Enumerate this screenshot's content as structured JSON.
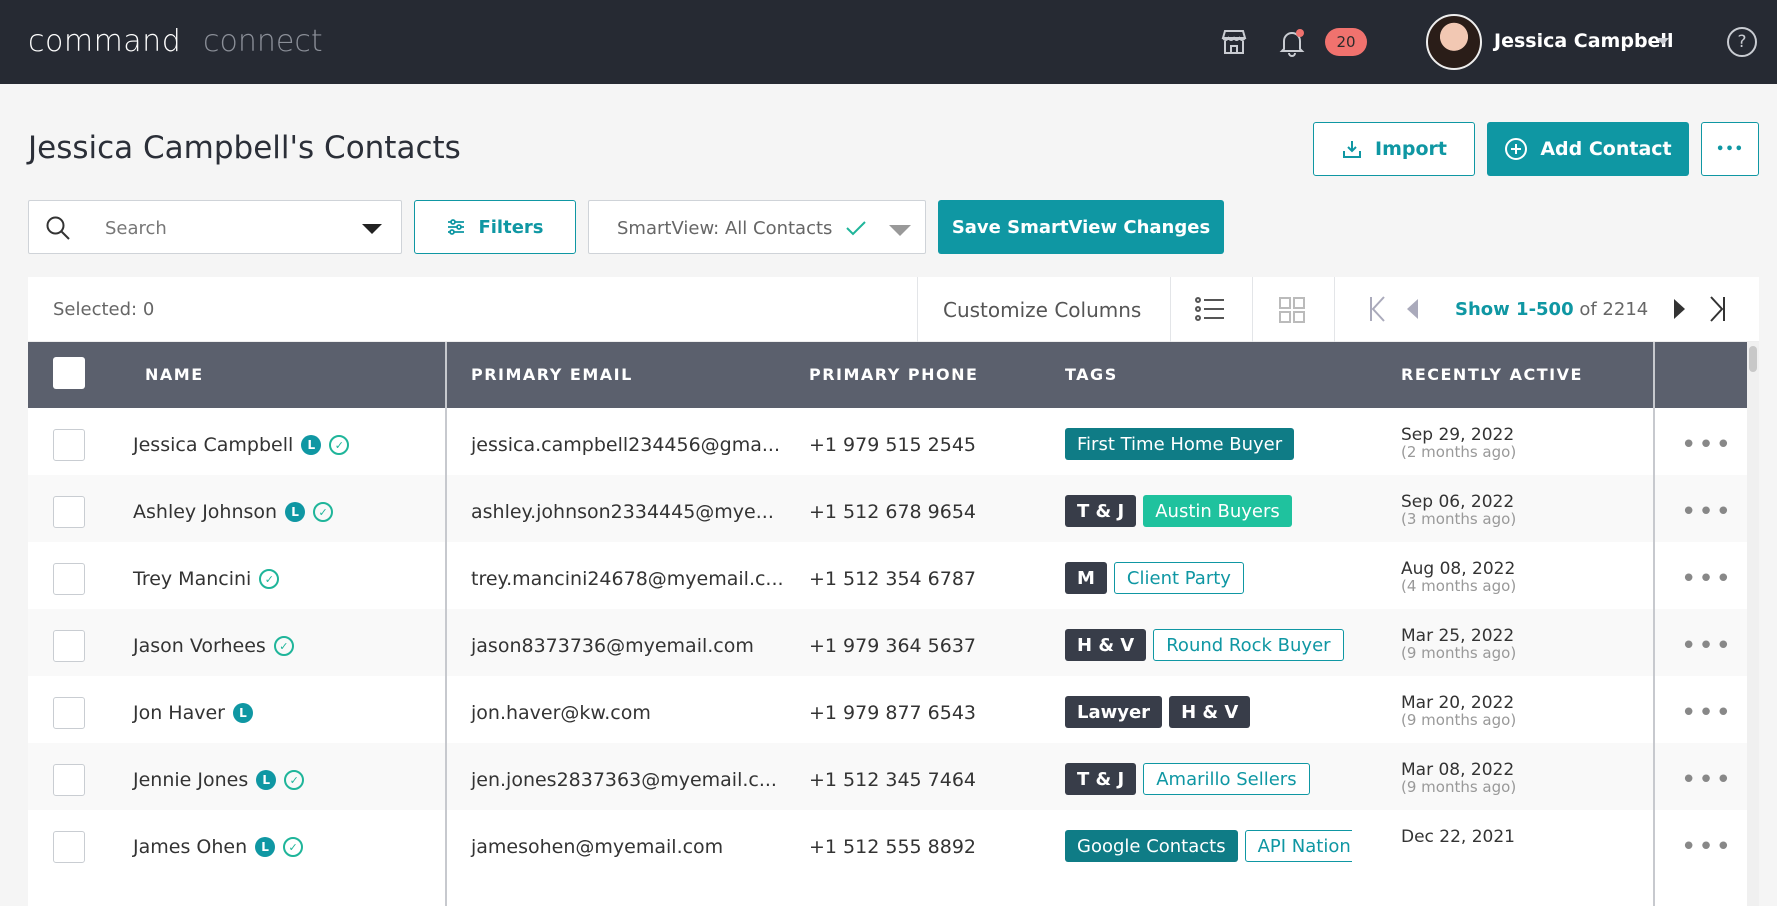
{
  "topbar": {
    "brand_command": "command",
    "brand_connect": "connect",
    "notification_count": "20",
    "user_name": "Jessica Campbell",
    "help_label": "?"
  },
  "header": {
    "title": "Jessica Campbell's Contacts",
    "import_label": "Import",
    "add_contact_label": "Add Contact",
    "more_label": "•••"
  },
  "toolbar": {
    "search_placeholder": "Search",
    "filters_label": "Filters",
    "smartview_label": "SmartView: All Contacts",
    "save_label": "Save SmartView Changes"
  },
  "statusbar": {
    "selected": "Selected: 0",
    "customize_label": "Customize Columns",
    "show_label": "Show 1-500",
    "show_total": "of 2214"
  },
  "columns": {
    "name": "NAME",
    "email": "PRIMARY EMAIL",
    "phone": "PRIMARY PHONE",
    "tags": "TAGS",
    "recent": "RECENTLY ACTIVE"
  },
  "badges": {
    "l": "L",
    "v": "✓"
  },
  "rows": [
    {
      "name": "Jessica Campbell",
      "l": true,
      "v": true,
      "email": "jessica.campbell234456@gma...",
      "phone": "+1 979 515 2545",
      "tags": [
        {
          "label": "First Time Home Buyer",
          "style": "teal"
        }
      ],
      "date": "Sep 29, 2022",
      "ago": "(2 months ago)"
    },
    {
      "name": "Ashley Johnson",
      "l": true,
      "v": true,
      "email": "ashley.johnson2334445@mye...",
      "phone": "+1 512 678 9654",
      "tags": [
        {
          "label": "T & J",
          "style": "dark"
        },
        {
          "label": "Austin Buyers",
          "style": "green"
        }
      ],
      "date": "Sep 06, 2022",
      "ago": "(3 months ago)"
    },
    {
      "name": "Trey Mancini",
      "l": false,
      "v": true,
      "email": "trey.mancini24678@myemail.c...",
      "phone": "+1 512 354 6787",
      "tags": [
        {
          "label": "M",
          "style": "dark"
        },
        {
          "label": "Client Party",
          "style": "outline"
        }
      ],
      "date": "Aug 08, 2022",
      "ago": "(4 months ago)"
    },
    {
      "name": "Jason Vorhees",
      "l": false,
      "v": true,
      "email": "jason8373736@myemail.com",
      "phone": "+1 979 364 5637",
      "tags": [
        {
          "label": "H & V",
          "style": "dark"
        },
        {
          "label": "Round Rock Buyer",
          "style": "outline"
        }
      ],
      "date": "Mar 25, 2022",
      "ago": "(9 months ago)"
    },
    {
      "name": "Jon Haver",
      "l": true,
      "v": false,
      "email": "jon.haver@kw.com",
      "phone": "+1 979 877 6543",
      "tags": [
        {
          "label": "Lawyer",
          "style": "dark"
        },
        {
          "label": "H & V",
          "style": "dark"
        }
      ],
      "date": "Mar 20, 2022",
      "ago": "(9 months ago)"
    },
    {
      "name": "Jennie Jones",
      "l": true,
      "v": true,
      "email": "jen.jones2837363@myemail.c...",
      "phone": "+1 512 345 7464",
      "tags": [
        {
          "label": "T & J",
          "style": "dark"
        },
        {
          "label": "Amarillo Sellers",
          "style": "outline"
        }
      ],
      "date": "Mar 08, 2022",
      "ago": "(9 months ago)"
    },
    {
      "name": "James Ohen",
      "l": true,
      "v": true,
      "email": "jamesohen@myemail.com",
      "phone": "+1 512 555 8892",
      "tags": [
        {
          "label": "Google Contacts",
          "style": "teal"
        },
        {
          "label": "API Nation",
          "style": "outline"
        }
      ],
      "date": "Dec 22, 2021",
      "ago": ""
    }
  ],
  "colors": {
    "accent": "#0f97a3",
    "topbar": "#262a33",
    "table_header": "#5b606d"
  }
}
